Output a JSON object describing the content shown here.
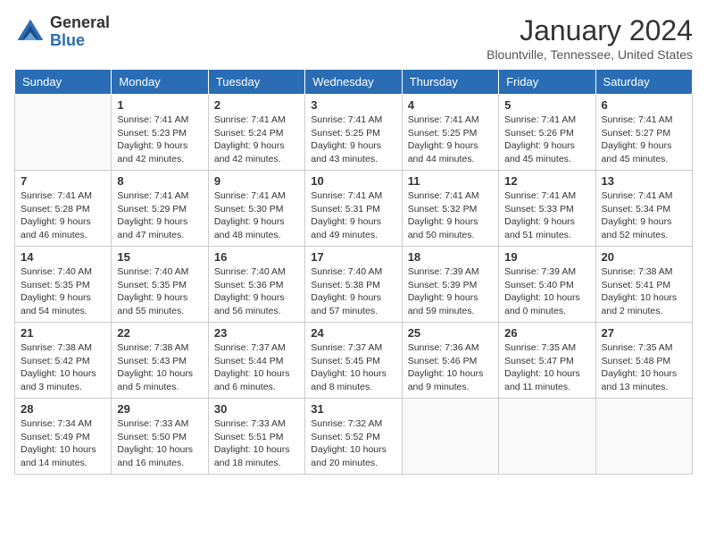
{
  "header": {
    "logo_general": "General",
    "logo_blue": "Blue",
    "month_title": "January 2024",
    "location": "Blountville, Tennessee, United States"
  },
  "days_of_week": [
    "Sunday",
    "Monday",
    "Tuesday",
    "Wednesday",
    "Thursday",
    "Friday",
    "Saturday"
  ],
  "weeks": [
    [
      {
        "day": "",
        "info": ""
      },
      {
        "day": "1",
        "info": "Sunrise: 7:41 AM\nSunset: 5:23 PM\nDaylight: 9 hours\nand 42 minutes."
      },
      {
        "day": "2",
        "info": "Sunrise: 7:41 AM\nSunset: 5:24 PM\nDaylight: 9 hours\nand 42 minutes."
      },
      {
        "day": "3",
        "info": "Sunrise: 7:41 AM\nSunset: 5:25 PM\nDaylight: 9 hours\nand 43 minutes."
      },
      {
        "day": "4",
        "info": "Sunrise: 7:41 AM\nSunset: 5:25 PM\nDaylight: 9 hours\nand 44 minutes."
      },
      {
        "day": "5",
        "info": "Sunrise: 7:41 AM\nSunset: 5:26 PM\nDaylight: 9 hours\nand 45 minutes."
      },
      {
        "day": "6",
        "info": "Sunrise: 7:41 AM\nSunset: 5:27 PM\nDaylight: 9 hours\nand 45 minutes."
      }
    ],
    [
      {
        "day": "7",
        "info": "Sunrise: 7:41 AM\nSunset: 5:28 PM\nDaylight: 9 hours\nand 46 minutes."
      },
      {
        "day": "8",
        "info": "Sunrise: 7:41 AM\nSunset: 5:29 PM\nDaylight: 9 hours\nand 47 minutes."
      },
      {
        "day": "9",
        "info": "Sunrise: 7:41 AM\nSunset: 5:30 PM\nDaylight: 9 hours\nand 48 minutes."
      },
      {
        "day": "10",
        "info": "Sunrise: 7:41 AM\nSunset: 5:31 PM\nDaylight: 9 hours\nand 49 minutes."
      },
      {
        "day": "11",
        "info": "Sunrise: 7:41 AM\nSunset: 5:32 PM\nDaylight: 9 hours\nand 50 minutes."
      },
      {
        "day": "12",
        "info": "Sunrise: 7:41 AM\nSunset: 5:33 PM\nDaylight: 9 hours\nand 51 minutes."
      },
      {
        "day": "13",
        "info": "Sunrise: 7:41 AM\nSunset: 5:34 PM\nDaylight: 9 hours\nand 52 minutes."
      }
    ],
    [
      {
        "day": "14",
        "info": "Sunrise: 7:40 AM\nSunset: 5:35 PM\nDaylight: 9 hours\nand 54 minutes."
      },
      {
        "day": "15",
        "info": "Sunrise: 7:40 AM\nSunset: 5:35 PM\nDaylight: 9 hours\nand 55 minutes."
      },
      {
        "day": "16",
        "info": "Sunrise: 7:40 AM\nSunset: 5:36 PM\nDaylight: 9 hours\nand 56 minutes."
      },
      {
        "day": "17",
        "info": "Sunrise: 7:40 AM\nSunset: 5:38 PM\nDaylight: 9 hours\nand 57 minutes."
      },
      {
        "day": "18",
        "info": "Sunrise: 7:39 AM\nSunset: 5:39 PM\nDaylight: 9 hours\nand 59 minutes."
      },
      {
        "day": "19",
        "info": "Sunrise: 7:39 AM\nSunset: 5:40 PM\nDaylight: 10 hours\nand 0 minutes."
      },
      {
        "day": "20",
        "info": "Sunrise: 7:38 AM\nSunset: 5:41 PM\nDaylight: 10 hours\nand 2 minutes."
      }
    ],
    [
      {
        "day": "21",
        "info": "Sunrise: 7:38 AM\nSunset: 5:42 PM\nDaylight: 10 hours\nand 3 minutes."
      },
      {
        "day": "22",
        "info": "Sunrise: 7:38 AM\nSunset: 5:43 PM\nDaylight: 10 hours\nand 5 minutes."
      },
      {
        "day": "23",
        "info": "Sunrise: 7:37 AM\nSunset: 5:44 PM\nDaylight: 10 hours\nand 6 minutes."
      },
      {
        "day": "24",
        "info": "Sunrise: 7:37 AM\nSunset: 5:45 PM\nDaylight: 10 hours\nand 8 minutes."
      },
      {
        "day": "25",
        "info": "Sunrise: 7:36 AM\nSunset: 5:46 PM\nDaylight: 10 hours\nand 9 minutes."
      },
      {
        "day": "26",
        "info": "Sunrise: 7:35 AM\nSunset: 5:47 PM\nDaylight: 10 hours\nand 11 minutes."
      },
      {
        "day": "27",
        "info": "Sunrise: 7:35 AM\nSunset: 5:48 PM\nDaylight: 10 hours\nand 13 minutes."
      }
    ],
    [
      {
        "day": "28",
        "info": "Sunrise: 7:34 AM\nSunset: 5:49 PM\nDaylight: 10 hours\nand 14 minutes."
      },
      {
        "day": "29",
        "info": "Sunrise: 7:33 AM\nSunset: 5:50 PM\nDaylight: 10 hours\nand 16 minutes."
      },
      {
        "day": "30",
        "info": "Sunrise: 7:33 AM\nSunset: 5:51 PM\nDaylight: 10 hours\nand 18 minutes."
      },
      {
        "day": "31",
        "info": "Sunrise: 7:32 AM\nSunset: 5:52 PM\nDaylight: 10 hours\nand 20 minutes."
      },
      {
        "day": "",
        "info": ""
      },
      {
        "day": "",
        "info": ""
      },
      {
        "day": "",
        "info": ""
      }
    ]
  ]
}
